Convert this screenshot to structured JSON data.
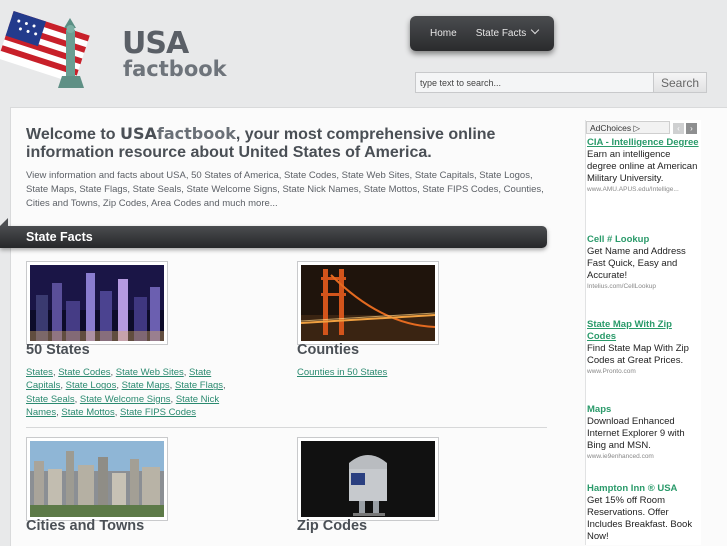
{
  "header": {
    "logo_usa": "USA",
    "logo_factbook": "factbook",
    "nav": {
      "home": "Home",
      "state_facts": "State Facts"
    },
    "search": {
      "placeholder": "type text to search...",
      "button": "Search"
    }
  },
  "welcome": {
    "prefix": "Welcome to ",
    "brand_usa": "USA",
    "brand_factbook": "factbook",
    "suffix": ", your most comprehensive online information resource about United States of America.",
    "intro": "View information and facts about USA, 50 States of America, State Codes, State Web Sites, State Capitals, State Logos, State Maps, State Flags, State Seals, State Welcome Signs, State Nick Names, State Mottos, State FIPS Codes, Counties, Cities and Towns, Zip Codes, Area Codes and much more..."
  },
  "section": {
    "title": "State Facts"
  },
  "cards": [
    {
      "title": "50 States",
      "links": [
        "States",
        "State Codes",
        "State Web Sites",
        "State Capitals",
        "State Logos",
        "State Maps",
        "State Flags",
        "State Seals",
        "State Welcome Signs",
        "State Nick Names",
        "State Mottos",
        "State FIPS Codes"
      ]
    },
    {
      "title": "Counties",
      "links": [
        "Counties in 50 States"
      ]
    },
    {
      "title": "Cities and Towns",
      "links": []
    },
    {
      "title": "Zip Codes",
      "links": []
    }
  ],
  "ads": {
    "adchoices": "AdChoices",
    "items": [
      {
        "title": "CIA - Intelligence Degree",
        "desc": "Earn an intelligence degree online at American Military University.",
        "url": "www.AMU.APUS.edu/Intellige..."
      },
      {
        "title": "Cell # Lookup",
        "desc": "Get Name and Address Fast Quick, Easy and Accurate!",
        "url": "Intelius.com/CellLookup"
      },
      {
        "title": "State Map With Zip Codes",
        "desc": "Find State Map With Zip Codes at Great Prices.",
        "url": "www.Pronto.com"
      },
      {
        "title": "Maps",
        "desc": "Download Enhanced Internet Explorer 9 with Bing and MSN.",
        "url": "www.ie9enhanced.com"
      },
      {
        "title": "Hampton Inn ® USA",
        "desc": "Get 15% off Room Reservations. Offer Includes Breakfast. Book Now!",
        "url": ""
      }
    ]
  },
  "colors": {
    "link": "#2b8a70",
    "ad_title": "#2a9a6a",
    "nav_bg": "#2a2b2d"
  }
}
